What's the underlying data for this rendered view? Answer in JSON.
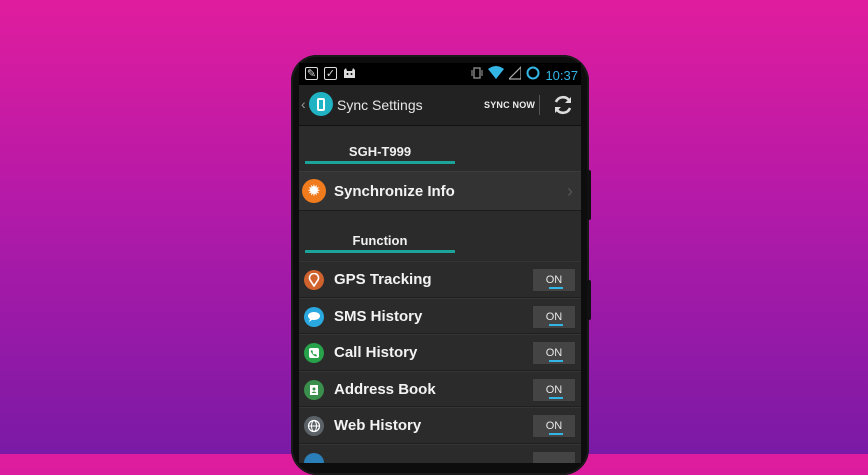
{
  "status_bar": {
    "time": "10:37",
    "icons": [
      "notification-icon",
      "bag-icon",
      "cat-icon",
      "vibrate-icon",
      "wifi-icon",
      "signal-icon",
      "battery-icon"
    ]
  },
  "action_bar": {
    "back_glyph": "‹",
    "title": "Sync Settings",
    "sync_now_label": "SYNC NOW",
    "refresh_icon": "refresh-icon"
  },
  "device_section": {
    "title": "SGH-T999"
  },
  "synchronize_info": {
    "label": "Synchronize Info",
    "chevron": "›"
  },
  "function_section": {
    "title": "Function"
  },
  "functions": [
    {
      "label": "GPS Tracking",
      "icon": "location-pin-icon",
      "color": "#d0622e",
      "state": "ON"
    },
    {
      "label": "SMS History",
      "icon": "chat-bubble-icon",
      "color": "#2aa9e0",
      "state": "ON"
    },
    {
      "label": "Call History",
      "icon": "phone-icon",
      "color": "#27a14a",
      "state": "ON"
    },
    {
      "label": "Address Book",
      "icon": "contact-card-icon",
      "color": "#3b8f4c",
      "state": "ON"
    },
    {
      "label": "Web History",
      "icon": "globe-icon",
      "color": "#5c6368",
      "state": "ON"
    }
  ],
  "colors": {
    "background_top": "#e01c9e",
    "background_bottom": "#7a1aa6",
    "accent": "#33b5e5",
    "section_underline": "#1ba39a"
  }
}
